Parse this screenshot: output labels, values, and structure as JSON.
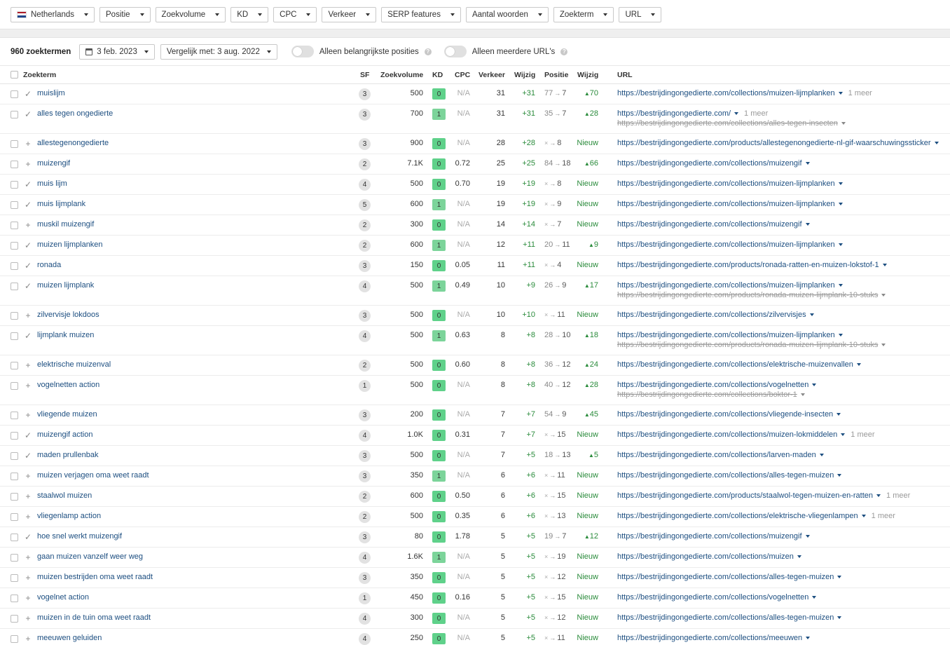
{
  "filters": [
    {
      "label": "Netherlands",
      "flag": true
    },
    {
      "label": "Positie"
    },
    {
      "label": "Zoekvolume"
    },
    {
      "label": "KD"
    },
    {
      "label": "CPC"
    },
    {
      "label": "Verkeer"
    },
    {
      "label": "SERP features"
    },
    {
      "label": "Aantal woorden"
    },
    {
      "label": "Zoekterm"
    },
    {
      "label": "URL"
    }
  ],
  "colors": {
    "flag_red": "#ae1c28",
    "flag_white": "#ffffff",
    "flag_blue": "#21468b",
    "link": "#1c4e80",
    "positive": "#2a8b3b",
    "kd_green": "#5fd18a"
  },
  "controls": {
    "count": "960 zoektermen",
    "date": "3 feb. 2023",
    "compare": "Vergelijk met: 3 aug. 2022",
    "toggle1": "Alleen belangrijkste posities",
    "toggle2": "Alleen meerdere URL's",
    "help_glyph": "?"
  },
  "headers": {
    "keyword": "Zoekterm",
    "sf": "SF",
    "volume": "Zoekvolume",
    "kd": "KD",
    "cpc": "CPC",
    "traffic": "Verkeer",
    "traffic_change": "Wijzig",
    "position": "Positie",
    "position_change": "Wijzig",
    "url": "URL"
  },
  "rows": [
    {
      "mark": "check",
      "kw": "muislijm",
      "sf": "3",
      "vol": "500",
      "kd": "0",
      "cpc": "N/A",
      "traf": "31",
      "tch": "+31",
      "pfrom": "77",
      "pto": "7",
      "pch": "70",
      "url": "https://bestrijdingongedierte.com/collections/muizen-lijmplanken",
      "more": "1 meer"
    },
    {
      "mark": "check",
      "kw": "alles tegen ongedierte",
      "sf": "3",
      "vol": "700",
      "kd": "1",
      "cpc": "N/A",
      "traf": "31",
      "tch": "+31",
      "pfrom": "35",
      "pto": "7",
      "pch": "28",
      "url": "https://bestrijdingongedierte.com/",
      "more": "1 meer",
      "url2": "https://bestrijdingongedierte.com/collections/alles-tegen-insecten"
    },
    {
      "mark": "plus",
      "kw": "allestegenongedierte",
      "sf": "3",
      "vol": "900",
      "kd": "0",
      "cpc": "N/A",
      "traf": "28",
      "tch": "+28",
      "pfrom": "×",
      "pto": "8",
      "pch": "Nieuw",
      "url": "https://bestrijdingongedierte.com/products/allestegenongedierte-nl-gif-waarschuwingssticker"
    },
    {
      "mark": "plus",
      "kw": "muizengif",
      "sf": "2",
      "vol": "7.1K",
      "kd": "0",
      "cpc": "0.72",
      "traf": "25",
      "tch": "+25",
      "pfrom": "84",
      "pto": "18",
      "pch": "66",
      "url": "https://bestrijdingongedierte.com/collections/muizengif"
    },
    {
      "mark": "check",
      "kw": "muis lijm",
      "sf": "4",
      "vol": "500",
      "kd": "0",
      "cpc": "0.70",
      "traf": "19",
      "tch": "+19",
      "pfrom": "×",
      "pto": "8",
      "pch": "Nieuw",
      "url": "https://bestrijdingongedierte.com/collections/muizen-lijmplanken"
    },
    {
      "mark": "check",
      "kw": "muis lijmplank",
      "sf": "5",
      "vol": "600",
      "kd": "1",
      "cpc": "N/A",
      "traf": "19",
      "tch": "+19",
      "pfrom": "×",
      "pto": "9",
      "pch": "Nieuw",
      "url": "https://bestrijdingongedierte.com/collections/muizen-lijmplanken"
    },
    {
      "mark": "plus",
      "kw": "muskil muizengif",
      "sf": "2",
      "vol": "300",
      "kd": "0",
      "cpc": "N/A",
      "traf": "14",
      "tch": "+14",
      "pfrom": "×",
      "pto": "7",
      "pch": "Nieuw",
      "url": "https://bestrijdingongedierte.com/collections/muizengif"
    },
    {
      "mark": "check",
      "kw": "muizen lijmplanken",
      "sf": "2",
      "vol": "600",
      "kd": "1",
      "cpc": "N/A",
      "traf": "12",
      "tch": "+11",
      "pfrom": "20",
      "pto": "11",
      "pch": "9",
      "url": "https://bestrijdingongedierte.com/collections/muizen-lijmplanken"
    },
    {
      "mark": "check",
      "kw": "ronada",
      "sf": "3",
      "vol": "150",
      "kd": "0",
      "cpc": "0.05",
      "traf": "11",
      "tch": "+11",
      "pfrom": "×",
      "pto": "4",
      "pch": "Nieuw",
      "url": "https://bestrijdingongedierte.com/products/ronada-ratten-en-muizen-lokstof-1"
    },
    {
      "mark": "check",
      "kw": "muizen lijmplank",
      "sf": "4",
      "vol": "500",
      "kd": "1",
      "cpc": "0.49",
      "traf": "10",
      "tch": "+9",
      "pfrom": "26",
      "pto": "9",
      "pch": "17",
      "url": "https://bestrijdingongedierte.com/collections/muizen-lijmplanken",
      "url2": "https://bestrijdingongedierte.com/products/ronada-muizen-lijmplank-10-stuks"
    },
    {
      "mark": "plus",
      "kw": "zilvervisje lokdoos",
      "sf": "3",
      "vol": "500",
      "kd": "0",
      "cpc": "N/A",
      "traf": "10",
      "tch": "+10",
      "pfrom": "×",
      "pto": "11",
      "pch": "Nieuw",
      "url": "https://bestrijdingongedierte.com/collections/zilvervisjes"
    },
    {
      "mark": "check",
      "kw": "lijmplank muizen",
      "sf": "4",
      "vol": "500",
      "kd": "1",
      "cpc": "0.63",
      "traf": "8",
      "tch": "+8",
      "pfrom": "28",
      "pto": "10",
      "pch": "18",
      "url": "https://bestrijdingongedierte.com/collections/muizen-lijmplanken",
      "url2": "https://bestrijdingongedierte.com/products/ronada-muizen-lijmplank-10-stuks"
    },
    {
      "mark": "plus",
      "kw": "elektrische muizenval",
      "sf": "2",
      "vol": "500",
      "kd": "0",
      "cpc": "0.60",
      "traf": "8",
      "tch": "+8",
      "pfrom": "36",
      "pto": "12",
      "pch": "24",
      "url": "https://bestrijdingongedierte.com/collections/elektrische-muizenvallen"
    },
    {
      "mark": "plus",
      "kw": "vogelnetten action",
      "sf": "1",
      "vol": "500",
      "kd": "0",
      "cpc": "N/A",
      "traf": "8",
      "tch": "+8",
      "pfrom": "40",
      "pto": "12",
      "pch": "28",
      "url": "https://bestrijdingongedierte.com/collections/vogelnetten",
      "url2": "https://bestrijdingongedierte.com/collections/boktor-1"
    },
    {
      "mark": "plus",
      "kw": "vliegende muizen",
      "sf": "3",
      "vol": "200",
      "kd": "0",
      "cpc": "N/A",
      "traf": "7",
      "tch": "+7",
      "pfrom": "54",
      "pto": "9",
      "pch": "45",
      "url": "https://bestrijdingongedierte.com/collections/vliegende-insecten"
    },
    {
      "mark": "check",
      "kw": "muizengif action",
      "sf": "4",
      "vol": "1.0K",
      "kd": "0",
      "cpc": "0.31",
      "traf": "7",
      "tch": "+7",
      "pfrom": "×",
      "pto": "15",
      "pch": "Nieuw",
      "url": "https://bestrijdingongedierte.com/collections/muizen-lokmiddelen",
      "more": "1 meer"
    },
    {
      "mark": "check",
      "kw": "maden prullenbak",
      "sf": "3",
      "vol": "500",
      "kd": "0",
      "cpc": "N/A",
      "traf": "7",
      "tch": "+5",
      "pfrom": "18",
      "pto": "13",
      "pch": "5",
      "url": "https://bestrijdingongedierte.com/collections/larven-maden"
    },
    {
      "mark": "plus",
      "kw": "muizen verjagen oma weet raadt",
      "sf": "3",
      "vol": "350",
      "kd": "1",
      "cpc": "N/A",
      "traf": "6",
      "tch": "+6",
      "pfrom": "×",
      "pto": "11",
      "pch": "Nieuw",
      "url": "https://bestrijdingongedierte.com/collections/alles-tegen-muizen"
    },
    {
      "mark": "plus",
      "kw": "staalwol muizen",
      "sf": "2",
      "vol": "600",
      "kd": "0",
      "cpc": "0.50",
      "traf": "6",
      "tch": "+6",
      "pfrom": "×",
      "pto": "15",
      "pch": "Nieuw",
      "url": "https://bestrijdingongedierte.com/products/staalwol-tegen-muizen-en-ratten",
      "more": "1 meer"
    },
    {
      "mark": "plus",
      "kw": "vliegenlamp action",
      "sf": "2",
      "vol": "500",
      "kd": "0",
      "cpc": "0.35",
      "traf": "6",
      "tch": "+6",
      "pfrom": "×",
      "pto": "13",
      "pch": "Nieuw",
      "url": "https://bestrijdingongedierte.com/collections/elektrische-vliegenlampen",
      "more": "1 meer"
    },
    {
      "mark": "check",
      "kw": "hoe snel werkt muizengif",
      "sf": "3",
      "vol": "80",
      "kd": "0",
      "cpc": "1.78",
      "traf": "5",
      "tch": "+5",
      "pfrom": "19",
      "pto": "7",
      "pch": "12",
      "url": "https://bestrijdingongedierte.com/collections/muizengif"
    },
    {
      "mark": "plus",
      "kw": "gaan muizen vanzelf weer weg",
      "sf": "4",
      "vol": "1.6K",
      "kd": "1",
      "cpc": "N/A",
      "traf": "5",
      "tch": "+5",
      "pfrom": "×",
      "pto": "19",
      "pch": "Nieuw",
      "url": "https://bestrijdingongedierte.com/collections/muizen"
    },
    {
      "mark": "plus",
      "kw": "muizen bestrijden oma weet raadt",
      "sf": "3",
      "vol": "350",
      "kd": "0",
      "cpc": "N/A",
      "traf": "5",
      "tch": "+5",
      "pfrom": "×",
      "pto": "12",
      "pch": "Nieuw",
      "url": "https://bestrijdingongedierte.com/collections/alles-tegen-muizen"
    },
    {
      "mark": "plus",
      "kw": "vogelnet action",
      "sf": "1",
      "vol": "450",
      "kd": "0",
      "cpc": "0.16",
      "traf": "5",
      "tch": "+5",
      "pfrom": "×",
      "pto": "15",
      "pch": "Nieuw",
      "url": "https://bestrijdingongedierte.com/collections/vogelnetten"
    },
    {
      "mark": "plus",
      "kw": "muizen in de tuin oma weet raadt",
      "sf": "4",
      "vol": "300",
      "kd": "0",
      "cpc": "N/A",
      "traf": "5",
      "tch": "+5",
      "pfrom": "×",
      "pto": "12",
      "pch": "Nieuw",
      "url": "https://bestrijdingongedierte.com/collections/alles-tegen-muizen"
    },
    {
      "mark": "plus",
      "kw": "meeuwen geluiden",
      "sf": "4",
      "vol": "250",
      "kd": "0",
      "cpc": "N/A",
      "traf": "5",
      "tch": "+5",
      "pfrom": "×",
      "pto": "11",
      "pch": "Nieuw",
      "url": "https://bestrijdingongedierte.com/collections/meeuwen"
    }
  ]
}
